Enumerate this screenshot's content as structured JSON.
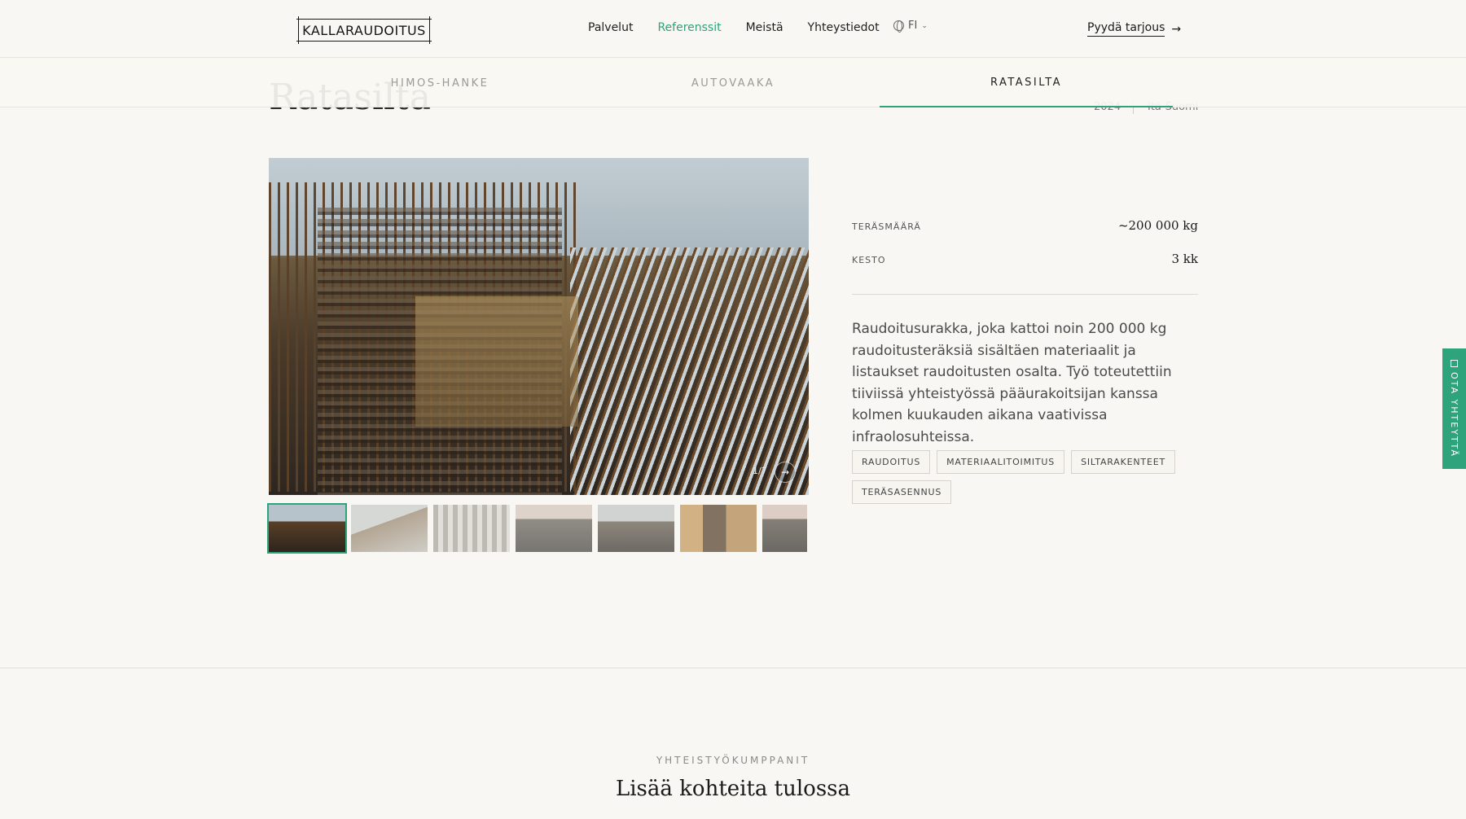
{
  "header": {
    "logo_text": "KALLARAUDOITUS",
    "nav": [
      "Palvelut",
      "Referenssit",
      "Meistä",
      "Yhteystiedot"
    ],
    "active_nav": "Referenssit",
    "lang": "FI",
    "cta_label": "Pyydä tarjous"
  },
  "tabs": [
    {
      "label": "HIMOS-HANKE",
      "active": false
    },
    {
      "label": "AUTOVAAKA",
      "active": false
    },
    {
      "label": "RATASILTA",
      "active": true
    }
  ],
  "behind": {
    "title": "Ratasilta",
    "year": "2024",
    "region": "Itä-Suomi"
  },
  "gallery": {
    "counter": "1/7",
    "thumb_count": 7
  },
  "specs": [
    {
      "label": "TERÄSMÄÄRÄ",
      "value": "~200 000 kg"
    },
    {
      "label": "KESTO",
      "value": "3 kk"
    }
  ],
  "description": "Raudoitusurakka, joka kattoi noin 200 000 kg raudoitusteräksiä sisältäen materiaalit ja listaukset raudoitusten osalta. Työ toteutettiin tiiviissä yhteistyössä pääurakoitsijan kanssa kolmen kuukauden aikana vaativissa infraolosuhteissa.",
  "tags": [
    "RAUDOITUS",
    "MATERIAALITOIMITUS",
    "SILTARAKENTEET",
    "TERÄSASENNUS"
  ],
  "side_tab": "OTA YHTEYTTÄ",
  "bottom": {
    "eyebrow": "YHTEISTYÖKUMPPANIT",
    "title": "Lisää kohteita tulossa"
  },
  "colors": {
    "accent": "#2fa37b",
    "background": "#f8f7f3"
  }
}
